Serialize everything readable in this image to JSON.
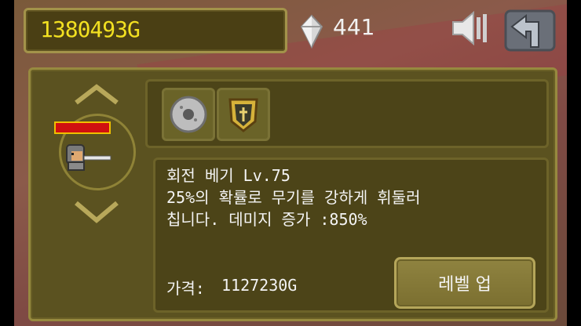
{
  "hud": {
    "gold": "1380493G",
    "gems": "441",
    "gem_icon": "gem-icon",
    "speaker_icon": "speaker-muted-icon",
    "back_icon": "back-arrow-icon"
  },
  "character": {
    "up_icon": "chevron-up-icon",
    "down_icon": "chevron-down-icon",
    "hp_color": "#d01010"
  },
  "skills": {
    "icons": [
      "saw-blade-icon",
      "shield-icon"
    ]
  },
  "detail": {
    "title": "회전 베기 Lv.75",
    "description": "25%의 확률로 무기를 강하게 휘둘러\n칩니다. 데미지 증가 :850%",
    "price_label": "가격:",
    "price_value": "1127230G",
    "levelup_label": "레벨 업"
  },
  "colors": {
    "gold_text": "#f2e021",
    "panel": "#5b5220",
    "border": "#978a3f"
  }
}
